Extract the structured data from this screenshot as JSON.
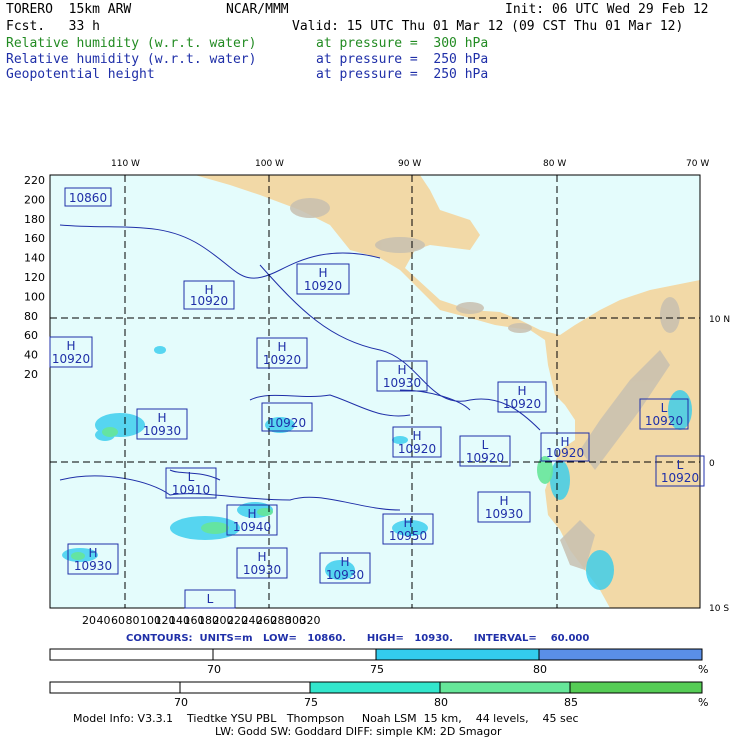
{
  "header": {
    "model": "TORERO  15km ARW",
    "org": "NCAR/MMM",
    "init": "Init: 06 UTC Wed 29 Feb 12",
    "fcst": "Fcst.   33 h",
    "valid": "Valid: 15 UTC Thu 01 Mar 12 (09 CST Thu 01 Mar 12)",
    "fields": [
      {
        "name": "Relative humidity (w.r.t. water)",
        "level": "at pressure =  300 hPa",
        "color": "#228b22"
      },
      {
        "name": "Relative humidity (w.r.t. water)",
        "level": "at pressure =  250 hPa",
        "color": "#1f2fa8"
      },
      {
        "name": "Geopotential height",
        "level": "at pressure =  250 hPa",
        "color": "#1f2fa8"
      }
    ]
  },
  "map": {
    "ocean_color": "#e4fcfc",
    "land_color": "#f2d9a7",
    "top_lon_labels": [
      "110 W",
      "100 W",
      "90 W",
      "80 W",
      "70 W"
    ],
    "right_lat_labels": [
      "10 N",
      "0",
      "10 S"
    ],
    "y_ticks": [
      "220",
      "200",
      "180",
      "160",
      "140",
      "120",
      "100",
      "80",
      "60",
      "40",
      "20"
    ],
    "x_ticks": [
      "20",
      "40",
      "60",
      "80",
      "100",
      "120",
      "140",
      "160",
      "180",
      "200",
      "220",
      "240",
      "260",
      "280",
      "300",
      "320"
    ],
    "centers": [
      {
        "letter": "",
        "value": "10860"
      },
      {
        "letter": "H",
        "value": "10920"
      },
      {
        "letter": "H",
        "value": "10920"
      },
      {
        "letter": "H",
        "value": "10920"
      },
      {
        "letter": "H",
        "value": "10920"
      },
      {
        "letter": "H",
        "value": "10930"
      },
      {
        "letter": "H",
        "value": "10930"
      },
      {
        "letter": "",
        "value": "10920"
      },
      {
        "letter": "H",
        "value": "10920"
      },
      {
        "letter": "H",
        "value": "10920"
      },
      {
        "letter": "L",
        "value": "10920"
      },
      {
        "letter": "L",
        "value": "10910"
      },
      {
        "letter": "H",
        "value": "10940"
      },
      {
        "letter": "H",
        "value": "10930"
      },
      {
        "letter": "H",
        "value": "10950"
      },
      {
        "letter": "H",
        "value": "10930"
      },
      {
        "letter": "H",
        "value": "10930"
      },
      {
        "letter": "H",
        "value": "10930"
      },
      {
        "letter": "L",
        "value": ""
      },
      {
        "letter": "H",
        "value": "10920"
      },
      {
        "letter": "L",
        "value": "10920"
      },
      {
        "letter": "L",
        "value": "10920"
      }
    ]
  },
  "contours_line": "CONTOURS:  UNITS=m   LOW=   10860.      HIGH=   10930.      INTERVAL=    60.000",
  "colorbar1": {
    "labels": [
      "70",
      "75",
      "80",
      "%"
    ],
    "colors": [
      "#ffffff",
      "#33ccee",
      "#5a8fe8"
    ]
  },
  "colorbar2": {
    "labels": [
      "70",
      "75",
      "80",
      "85",
      "%"
    ],
    "colors": [
      "#ffffff",
      "#33e6cc",
      "#66e699",
      "#55cc55"
    ]
  },
  "footer": {
    "line1": "Model Info: V3.3.1    Tiedtke YSU PBL   Thompson     Noah LSM  15 km,    44 levels,    45 sec",
    "line2": "LW: Godd SW: Goddard DIFF: simple KM: 2D Smagor"
  }
}
